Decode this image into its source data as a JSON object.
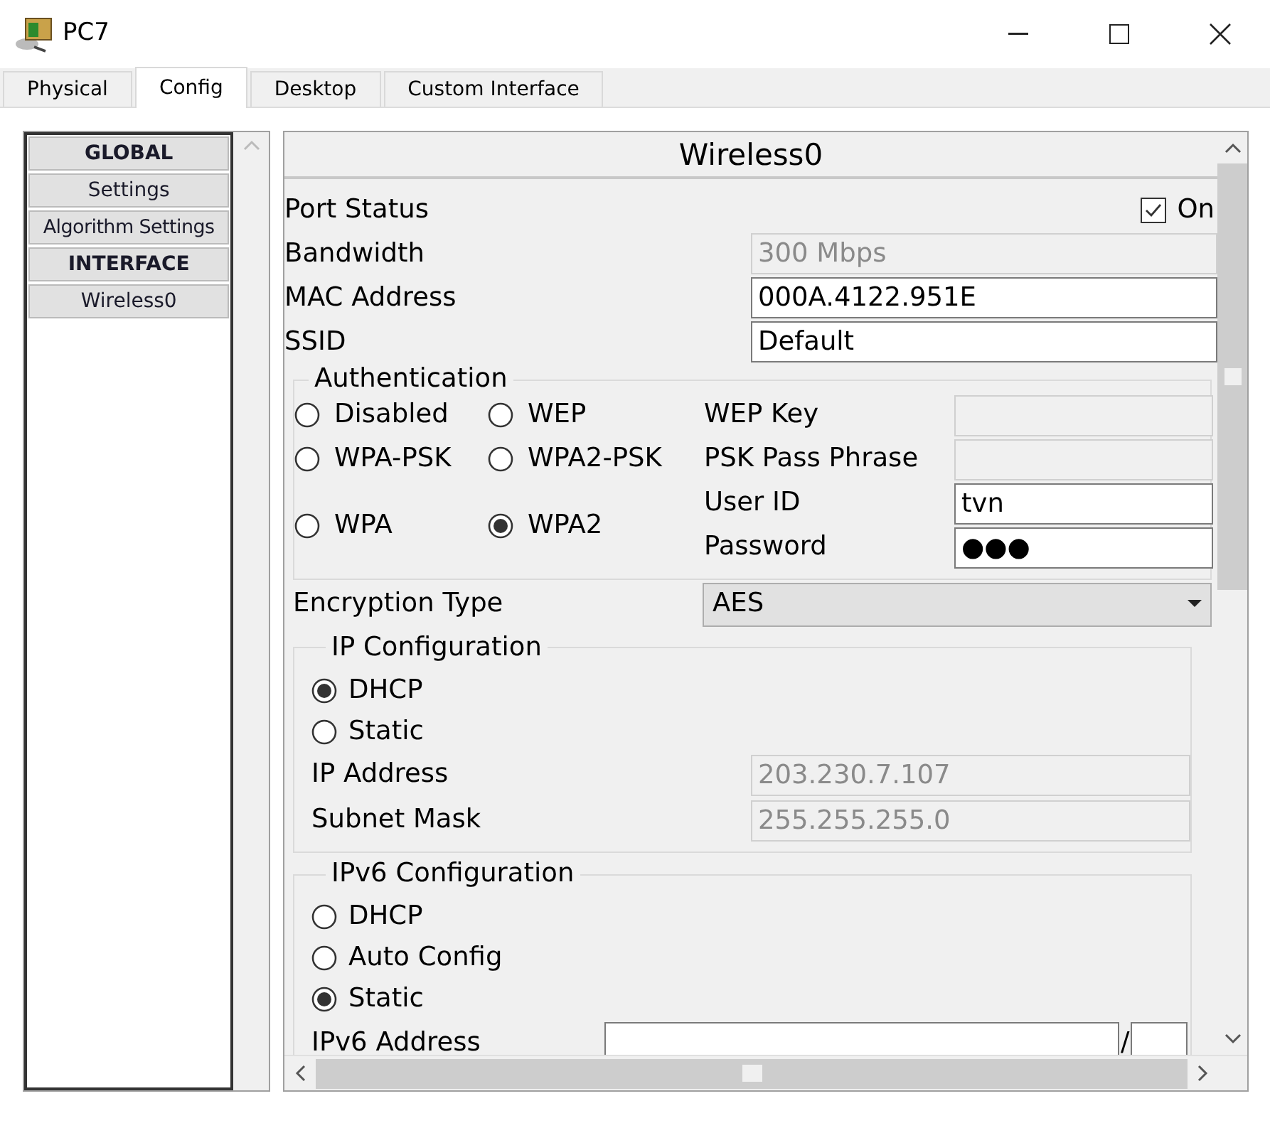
{
  "window": {
    "title": "PC7"
  },
  "tabs": [
    {
      "label": "Physical",
      "selected": false
    },
    {
      "label": "Config",
      "selected": true
    },
    {
      "label": "Desktop",
      "selected": false
    },
    {
      "label": "Custom Interface",
      "selected": false
    }
  ],
  "sidebar": {
    "items": [
      {
        "label": "GLOBAL",
        "kind": "header"
      },
      {
        "label": "Settings",
        "kind": "item"
      },
      {
        "label": "Algorithm Settings",
        "kind": "item"
      },
      {
        "label": "INTERFACE",
        "kind": "header"
      },
      {
        "label": "Wireless0",
        "kind": "item"
      }
    ]
  },
  "panel": {
    "title": "Wireless0",
    "port_status": {
      "label": "Port Status",
      "checkbox_label": "On",
      "checked": true
    },
    "fields": [
      {
        "label": "Bandwidth",
        "value": "300 Mbps",
        "disabled": true
      },
      {
        "label": "MAC Address",
        "value": "000A.4122.951E",
        "disabled": false
      },
      {
        "label": "SSID",
        "value": "Default",
        "disabled": false
      }
    ],
    "authentication": {
      "legend": "Authentication",
      "options": [
        {
          "label": "Disabled",
          "selected": false
        },
        {
          "label": "WEP",
          "selected": false
        },
        {
          "label": "WPA-PSK",
          "selected": false
        },
        {
          "label": "WPA2-PSK",
          "selected": false
        },
        {
          "label": "WPA",
          "selected": false
        },
        {
          "label": "WPA2",
          "selected": true
        }
      ],
      "fields": [
        {
          "label": "WEP Key",
          "disabled": true
        },
        {
          "label": "PSK Pass Phrase",
          "disabled": true
        },
        {
          "label": "User ID",
          "value": "tvn",
          "disabled": false
        },
        {
          "label": "Password",
          "value": "●●●",
          "disabled": false
        }
      ]
    },
    "encryption": {
      "label": "Encryption Type",
      "value": "AES"
    },
    "ip_config": {
      "legend": "IP Configuration",
      "options": [
        {
          "label": "DHCP",
          "selected": true
        },
        {
          "label": "Static",
          "selected": false
        }
      ],
      "fields": [
        {
          "label": "IP Address",
          "value": "203.230.7.107",
          "disabled": true
        },
        {
          "label": "Subnet Mask",
          "value": "255.255.255.0",
          "disabled": true
        }
      ]
    },
    "ipv6_config": {
      "legend": "IPv6 Configuration",
      "options": [
        {
          "label": "DHCP",
          "selected": false
        },
        {
          "label": "Auto Config",
          "selected": false
        },
        {
          "label": "Static",
          "selected": true
        }
      ],
      "address": {
        "label": "IPv6 Address",
        "separator": "/"
      }
    }
  }
}
